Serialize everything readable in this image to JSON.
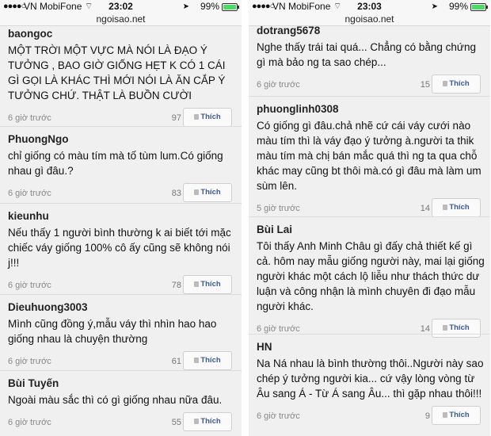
{
  "left": {
    "status": {
      "signal": "●●●●○",
      "carrier": "VN MobiFone",
      "wifi": "⌔",
      "time": "23:02",
      "location": "➤",
      "battery": "99%",
      "battery_level": 0.99
    },
    "url": "ngoisao.net",
    "comments": [
      {
        "name": "baongoc",
        "body": "MỘT TRỜI MỘT VỰC MÀ NÓI LÀ ĐẠO Ý TƯỞNG , BAO GIỜ GIỐNG HẸT K CÓ 1 CÁI GÌ GỌI LÀ KHÁC THÌ MỚI NÓI LÀ ĂN CẮP Ý TƯỞNG CHỨ. THẬT LÀ BUỒN CƯỜI",
        "time": "6 giờ trước",
        "likes": "97",
        "like_label": "Thích"
      },
      {
        "name": "PhuongNgo",
        "body": "chỉ giống có màu tím mà tố tùm lum.Có giống nhau gì đâu.?",
        "time": "6 giờ trước",
        "likes": "83",
        "like_label": "Thích"
      },
      {
        "name": "kieunhu",
        "body": "Nếu thấy 1 người bình thường k ai biết tới mặc chiếc váy giống 100% cô ấy cũng sẽ không nói j!!!",
        "time": "6 giờ trước",
        "likes": "78",
        "like_label": "Thích"
      },
      {
        "name": "Dieuhuong3003",
        "body": "Mình cũng đồng ý,mẫu váy thì nhìn hao hao giống nhau là chuyện thường",
        "time": "6 giờ trước",
        "likes": "61",
        "like_label": "Thích"
      },
      {
        "name": "Bùi Tuyến",
        "body": "Ngoài màu sắc thì có gì giống nhau nữa đâu.",
        "time": "6 giờ trước",
        "likes": "55",
        "like_label": "Thích"
      }
    ]
  },
  "right": {
    "status": {
      "signal": "●●●●○",
      "carrier": "VN MobiFone",
      "wifi": "⌔",
      "time": "23:03",
      "location": "➤",
      "battery": "99%",
      "battery_level": 0.99
    },
    "url": "ngoisao.net",
    "comments": [
      {
        "name": "dotrang5678",
        "body": "Nghe thấy trái tai quá... Chẳng có bằng chứng gì mà bảo ng ta sao chép...",
        "time": "6 giờ trước",
        "likes": "15",
        "like_label": "Thích"
      },
      {
        "name": "phuonglinh0308",
        "body": "Có giống gì đâu.chả nhẽ cứ cái váy cưới nào màu tím thì là váy đạo ý tưởng à.người ta thik màu tím mà chị bán mắc quá thì ng ta qua chỗ khác may cũng bt thôi mà.có gì đâu mà làm um sùm lên.",
        "time": "5 giờ trước",
        "likes": "14",
        "like_label": "Thích"
      },
      {
        "name": "Bùi Lai",
        "body": "Tôi thấy Anh Minh Châu gì đấy chả thiết kế gì cả. hôm nay mẫu giống người này, mai lại giống người khác một cách lộ liễu như thách thức dư luận và công nhận là mình chuyên đi đạo mẫu người khác.",
        "time": "6 giờ trước",
        "likes": "14",
        "like_label": "Thích"
      },
      {
        "name": "HN",
        "body": "Na Ná nhau là bình thường thôi..Người này sao chép ý tưởng người kia... cứ vậy lòng vòng từ Âu sang Á - Từ Á sang Âu... thì gặp nhau thôi!!!",
        "time": "6 giờ trước",
        "likes": "9",
        "like_label": "Thích"
      }
    ]
  }
}
